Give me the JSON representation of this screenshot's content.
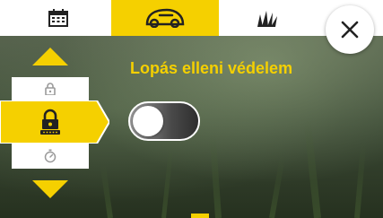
{
  "header": {
    "tabs": [
      {
        "icon": "calendar-icon",
        "selected": false
      },
      {
        "icon": "robotic-mower-icon",
        "selected": true
      },
      {
        "icon": "grass-icon",
        "selected": false
      }
    ],
    "close_icon": "close-icon"
  },
  "settings_menu": {
    "items": [
      {
        "icon": "lock-icon",
        "selected": false
      },
      {
        "icon": "lock-pin-icon",
        "selected": true
      },
      {
        "icon": "stopwatch-icon",
        "selected": false
      }
    ]
  },
  "main": {
    "title": "Lopás elleni védelem",
    "toggle_on": false
  },
  "colors": {
    "accent": "#f5d000",
    "toggle_off": "#4a4a4a",
    "background_dark": "#3c4a36"
  }
}
